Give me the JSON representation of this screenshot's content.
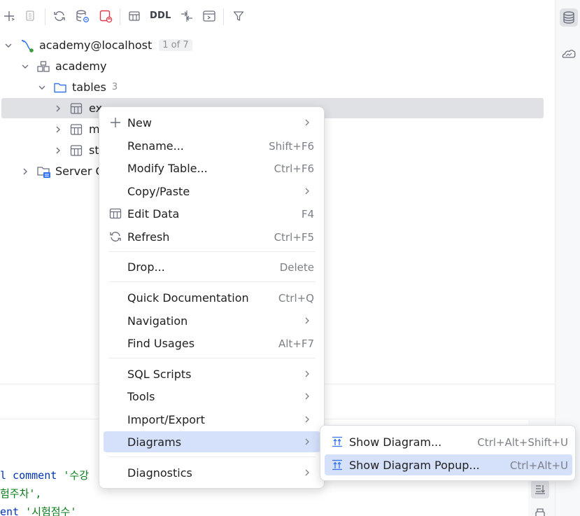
{
  "toolbar": {
    "icons": [
      "add-icon",
      "copy-icon",
      "refresh-icon",
      "data-source-properties-icon",
      "disconnect-icon",
      "table-icon",
      "compare-icon",
      "console-icon",
      "filter-icon"
    ],
    "ddl_label": "DDL"
  },
  "right_strip": {
    "icons": [
      "database-icon",
      "cloud-icon"
    ]
  },
  "tree": {
    "connection": {
      "label": "academy@localhost",
      "badge": "1 of 7"
    },
    "schema": {
      "label": "academy"
    },
    "folder": {
      "label": "tables",
      "count": "3"
    },
    "tables": [
      {
        "label": "ex"
      },
      {
        "label": "m"
      },
      {
        "label": "st"
      }
    ],
    "server_objects": {
      "label": "Server O"
    }
  },
  "code": {
    "line1_kw": "l comment",
    "line1_str": "'수강",
    "line2": "험주차',",
    "line3_kw": "ent",
    "line3_str": "'시험점수'"
  },
  "context_menu": {
    "items": [
      {
        "label": "New",
        "shortcut": "",
        "submenu": true,
        "icon": "plus-icon"
      },
      {
        "label": "Rename...",
        "shortcut": "Shift+F6",
        "submenu": false,
        "icon": ""
      },
      {
        "label": "Modify Table...",
        "shortcut": "Ctrl+F6",
        "submenu": false,
        "icon": ""
      },
      {
        "label": "Copy/Paste",
        "shortcut": "",
        "submenu": true,
        "icon": ""
      },
      {
        "label": "Edit Data",
        "shortcut": "F4",
        "submenu": false,
        "icon": "table-grid-icon"
      },
      {
        "label": "Refresh",
        "shortcut": "Ctrl+F5",
        "submenu": false,
        "icon": "refresh-icon"
      },
      {
        "label": "Drop...",
        "shortcut": "Delete",
        "submenu": false,
        "icon": ""
      },
      {
        "label": "Quick Documentation",
        "shortcut": "Ctrl+Q",
        "submenu": false,
        "icon": ""
      },
      {
        "label": "Navigation",
        "shortcut": "",
        "submenu": true,
        "icon": ""
      },
      {
        "label": "Find Usages",
        "shortcut": "Alt+F7",
        "submenu": false,
        "icon": ""
      },
      {
        "label": "SQL Scripts",
        "shortcut": "",
        "submenu": true,
        "icon": ""
      },
      {
        "label": "Tools",
        "shortcut": "",
        "submenu": true,
        "icon": ""
      },
      {
        "label": "Import/Export",
        "shortcut": "",
        "submenu": true,
        "icon": ""
      },
      {
        "label": "Diagrams",
        "shortcut": "",
        "submenu": true,
        "icon": "",
        "highlighted": true
      },
      {
        "label": "Diagnostics",
        "shortcut": "",
        "submenu": true,
        "icon": ""
      }
    ]
  },
  "diagrams_submenu": {
    "items": [
      {
        "label": "Show Diagram...",
        "shortcut": "Ctrl+Alt+Shift+U",
        "icon": "diagram-icon"
      },
      {
        "label": "Show Diagram Popup...",
        "shortcut": "Ctrl+Alt+U",
        "icon": "diagram-icon",
        "highlighted": true
      }
    ]
  },
  "colors": {
    "highlight": "#d5e0fb",
    "selection": "#dfe1e5",
    "keyword": "#0033b3",
    "string": "#067d17",
    "accent": "#3574f0"
  }
}
